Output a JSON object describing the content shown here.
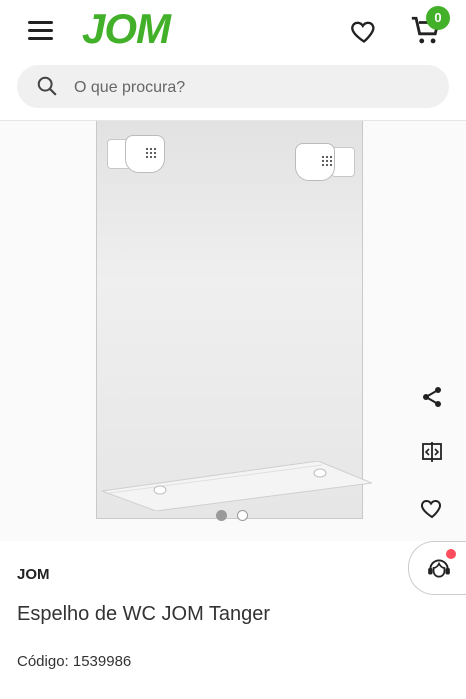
{
  "header": {
    "logo": "JOM",
    "cart_count": "0",
    "icons": [
      "menu-icon",
      "heart-icon",
      "cart-icon"
    ]
  },
  "search": {
    "placeholder": "O que procura?",
    "icon": "search-icon"
  },
  "gallery": {
    "image_count": 2,
    "active_index": 0,
    "side_actions": [
      "share-icon",
      "compare-icon",
      "heart-icon"
    ]
  },
  "product": {
    "brand": "JOM",
    "title": "Espelho de WC JOM Tanger",
    "code": "Código: 1539986"
  },
  "colors": {
    "accent": "#43b02a",
    "notification": "#ff4d5e"
  }
}
